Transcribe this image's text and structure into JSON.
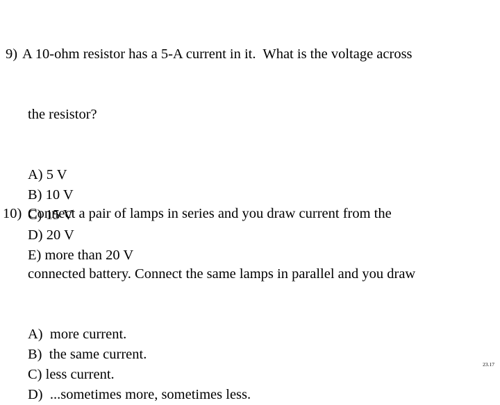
{
  "slide": {
    "background_color": "#ffffff",
    "text_color": "#000000",
    "slide_number": "23.17"
  },
  "questions": [
    {
      "number": "9)",
      "stem_lines": [
        "A 10-ohm resistor has a 5-A current in it.  What is the voltage across",
        "the resistor?"
      ],
      "options": [
        "A) 5 V",
        "B) 10 V",
        "C) 15 V",
        "D) 20 V",
        "E) more than 20 V"
      ]
    },
    {
      "number": "10)",
      "stem_lines": [
        "Connect a pair of lamps in series and you draw current from the",
        "connected battery. Connect the same lamps in parallel and you draw"
      ],
      "options": [
        "A)  more current.",
        "B)  the same current.",
        "C) less current.",
        "D)  ...sometimes more, sometimes less."
      ]
    }
  ]
}
